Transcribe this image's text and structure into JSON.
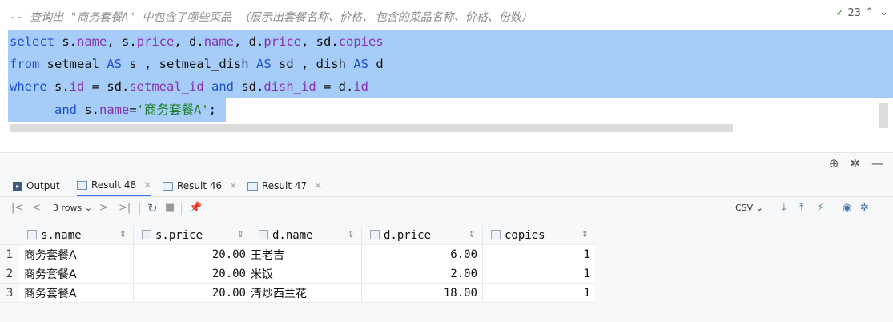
{
  "editor": {
    "comment": "-- 查询出 \"商务套餐A\" 中包含了哪些菜品 （展示出套餐名称、价格, 包含的菜品名称、价格、份数）",
    "inspection_count": "23",
    "line1": {
      "kw_select": "select",
      "s_a": "s.",
      "f_name": "name",
      ", ": ", ",
      "s_b": "s.",
      "f_price": "price",
      "sep2": ", d.",
      "f_name2": "name",
      "sep3": ", d.",
      "f_price2": "price",
      "sep4": ", sd.",
      "f_copies": "copies"
    },
    "line2": {
      "kw_from": "from",
      "rest1": " setmeal ",
      "kw_as1": "AS",
      "rest2": " s , setmeal_dish ",
      "kw_as2": "AS",
      "rest3": " sd , dish ",
      "kw_as3": "AS",
      "rest4": " d"
    },
    "line3": {
      "kw_where": "where",
      "rest1": " s.",
      "f_id": "id",
      "rest2": " = sd.",
      "f_setmeal_id": "setmeal_id",
      "rest3": " ",
      "kw_and": "and",
      "rest4": " sd.",
      "f_dish_id": "dish_id",
      "rest5": " = d.",
      "f_id2": "id"
    },
    "line4": {
      "kw_and": "and",
      "rest1": " s.",
      "f_name": "name",
      "rest2": "=",
      "str": "'商务套餐A'",
      "end": ";"
    }
  },
  "tabs": [
    {
      "label": "Output",
      "active": false,
      "closable": false
    },
    {
      "label": "Result 48",
      "active": true,
      "closable": true
    },
    {
      "label": "Result 46",
      "active": false,
      "closable": true
    },
    {
      "label": "Result 47",
      "active": false,
      "closable": true
    }
  ],
  "toolbar": {
    "rows_label": "3 rows",
    "first_icon": "|<",
    "prev_icon": "<",
    "next_icon": ">",
    "last_icon": ">|",
    "format_label": "CSV"
  },
  "grid": {
    "columns": [
      "s.name",
      "s.price",
      "d.name",
      "d.price",
      "copies"
    ],
    "rows": [
      {
        "n": "1",
        "s_name": "商务套餐A",
        "s_price": "20.00",
        "d_name": "王老吉",
        "d_price": "6.00",
        "copies": "1"
      },
      {
        "n": "2",
        "s_name": "商务套餐A",
        "s_price": "20.00",
        "d_name": "米饭",
        "d_price": "2.00",
        "copies": "1"
      },
      {
        "n": "3",
        "s_name": "商务套餐A",
        "s_price": "20.00",
        "d_name": "清炒西兰花",
        "d_price": "18.00",
        "copies": "1"
      }
    ]
  },
  "colors": {
    "selection": "#a6cdf7",
    "keyword": "#1d4fd0",
    "field": "#8b2fb5",
    "string": "#1a7d2a",
    "active_tab": "#3574f0"
  }
}
